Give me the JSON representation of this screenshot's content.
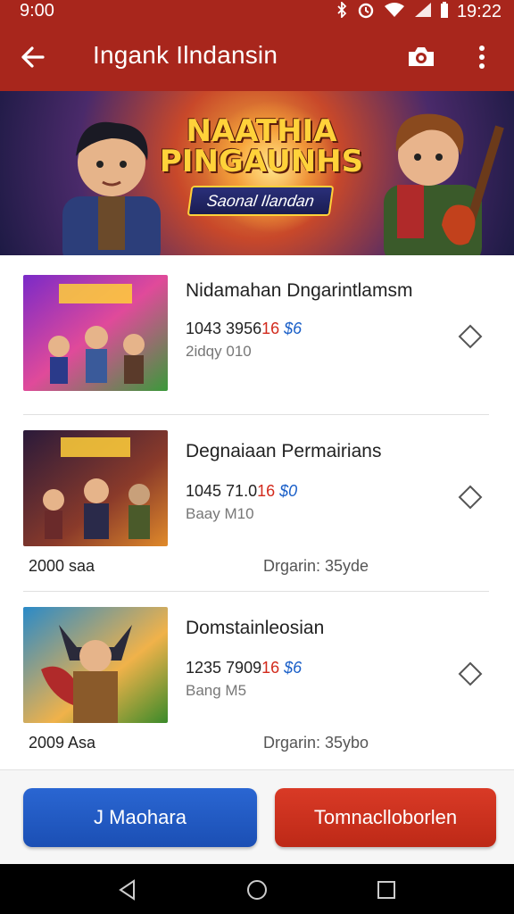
{
  "status": {
    "time": "9:00",
    "clock": "19:22",
    "icons": [
      "bluetooth-icon",
      "alarm-icon",
      "wifi-icon",
      "signal-icon",
      "battery-icon"
    ]
  },
  "app_bar": {
    "title": "Ingank Ilndansin",
    "back_icon": "arrow-left-icon",
    "camera_icon": "camera-icon",
    "more_icon": "more-vertical-icon"
  },
  "banner": {
    "title_line1": "NAATHIA",
    "title_line2": "PINGAUNHS",
    "subtitle": "Saonal Ilandan"
  },
  "items": [
    {
      "title": "Nidamahan Dngarintlamsm",
      "price_main": "1043 3956",
      "price_red": "16",
      "price_blue": "$6",
      "sub": "2idqy 010",
      "meta_left": "",
      "meta_right": ""
    },
    {
      "title": "Degnaiaan Permairians",
      "price_main": "1045 71.0",
      "price_red": "16",
      "price_blue": "$0",
      "sub": "Baay M10",
      "meta_left": "2000 saa",
      "meta_right": "Drgarin: 35yde"
    },
    {
      "title": "Domstainleosian",
      "price_main": "1235 7909",
      "price_red": "16",
      "price_blue": "$6",
      "sub": "Bang M5",
      "meta_left": "2009 Asa",
      "meta_right": "Drgarin: 35ybo"
    }
  ],
  "buttons": {
    "primary": "J Maohara",
    "secondary": "Tomnaclloborlen"
  },
  "colors": {
    "app_bar": "#a8261c",
    "primary_button": "#1b4fb4",
    "danger_button": "#bd2917",
    "price_red": "#d22a1c",
    "price_blue": "#1a5fc8"
  },
  "nav": {
    "back_icon": "triangle-back-icon",
    "home_icon": "circle-home-icon",
    "recents_icon": "square-recents-icon"
  }
}
